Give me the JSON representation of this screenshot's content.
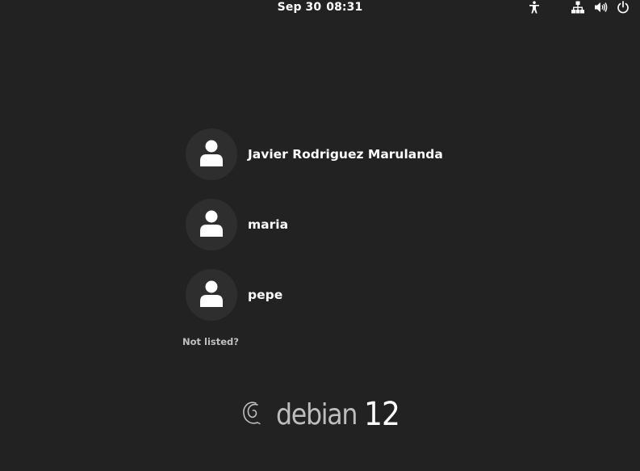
{
  "top_bar": {
    "date": "Sep 30",
    "time": "08:31",
    "icons": [
      "accessibility-icon",
      "network-icon",
      "volume-icon",
      "power-icon"
    ]
  },
  "users": [
    {
      "name": "Javier Rodriguez Marulanda",
      "avatar_icon": "user-icon"
    },
    {
      "name": "maria",
      "avatar_icon": "user-icon"
    },
    {
      "name": "pepe",
      "avatar_icon": "user-icon"
    }
  ],
  "not_listed_label": "Not listed?",
  "branding": {
    "word": "debian",
    "version": "12",
    "logo_icon": "debian-swirl-icon"
  },
  "colors": {
    "background": "#222222",
    "avatar_bg": "#2e2e2e",
    "text": "#ffffff",
    "muted_text": "#c0c0c0"
  }
}
